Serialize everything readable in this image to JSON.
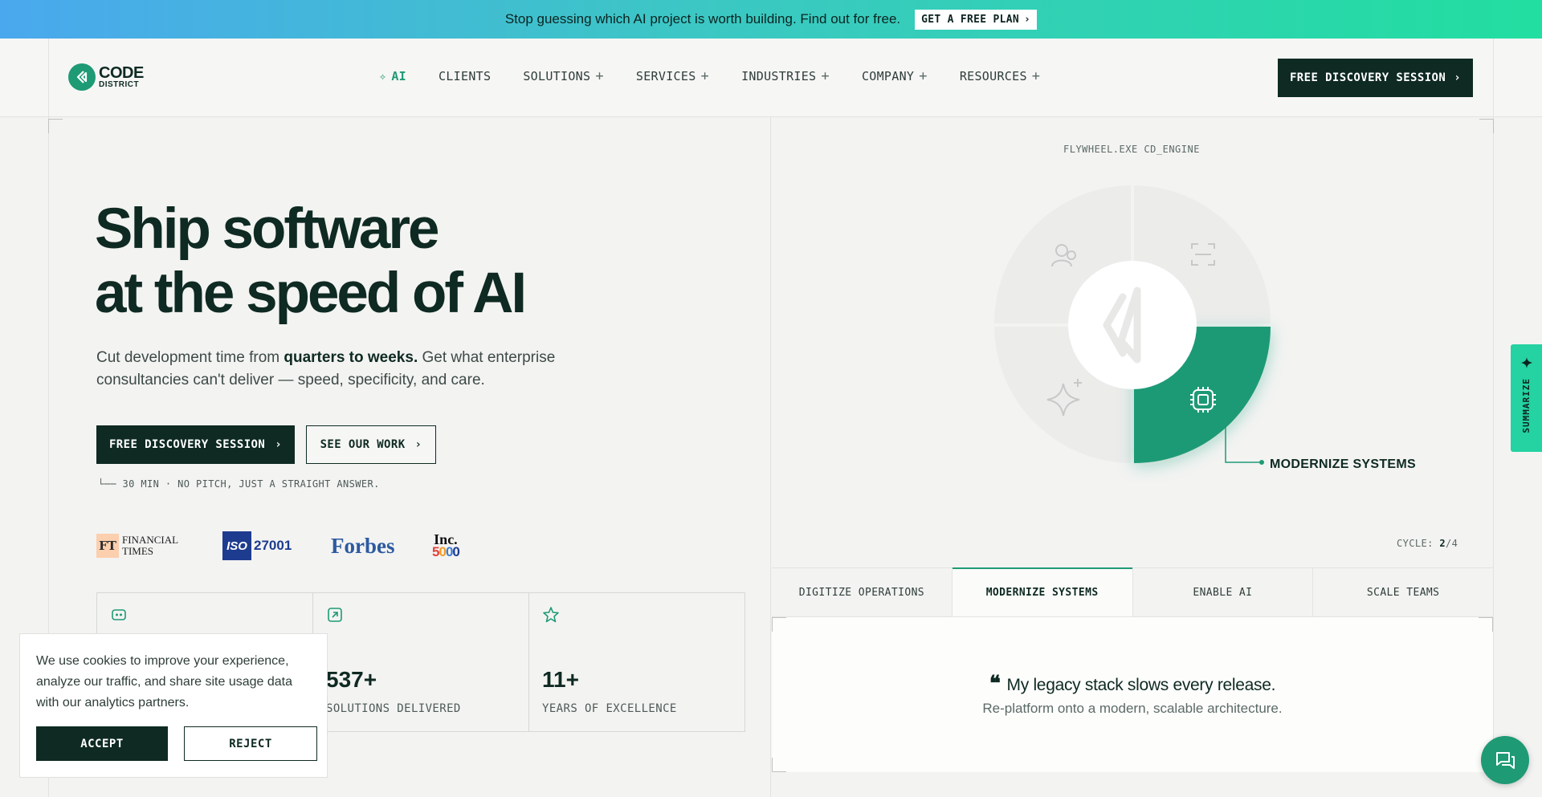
{
  "promo": {
    "text": "Stop guessing which AI project is worth building. Find out for free.",
    "button": "GET A FREE PLAN"
  },
  "header": {
    "logo_line1": "CODE",
    "logo_line2": "DISTRICT",
    "nav": {
      "ai": "AI",
      "clients": "CLIENTS",
      "solutions": "SOLUTIONS",
      "services": "SERVICES",
      "industries": "INDUSTRIES",
      "company": "COMPANY",
      "resources": "RESOURCES"
    },
    "cta": "FREE DISCOVERY SESSION"
  },
  "hero": {
    "title_line1": "Ship software",
    "title_line2": "at the speed of AI",
    "sub_pre": "Cut development time from ",
    "sub_bold": "quarters to weeks.",
    "sub_post": " Get what enterprise consultancies can't deliver — speed, specificity, and care.",
    "primary_button": "FREE DISCOVERY SESSION",
    "secondary_button": "SEE OUR WORK",
    "note": "30 MIN · NO PITCH, JUST A STRAIGHT ANSWER."
  },
  "press": {
    "ft_mark": "FT",
    "ft_line1": "FINANCIAL",
    "ft_line2": "TIMES",
    "iso_mark": "ISO",
    "iso_number": "27001",
    "forbes": "Forbes",
    "inc_top": "Inc.",
    "inc_bottom": "5000"
  },
  "stats": [
    {
      "icon": "robot-icon",
      "value": "",
      "label": ""
    },
    {
      "icon": "arrow-up-right-icon",
      "value": "537+",
      "label": "SOLUTIONS DELIVERED"
    },
    {
      "icon": "star-badge-icon",
      "value": "11+",
      "label": "YEARS OF EXCELLENCE"
    }
  ],
  "flywheel": {
    "title": "FLYWHEEL.EXE CD_ENGINE",
    "active_label": "MODERNIZE SYSTEMS",
    "cycle_label": "CYCLE: ",
    "cycle_current": "2",
    "cycle_total": "/4",
    "colors": {
      "active": "#1e9a74",
      "inactive": "#ececeb"
    }
  },
  "tabs": [
    "DIGITIZE OPERATIONS",
    "MODERNIZE SYSTEMS",
    "ENABLE AI",
    "SCALE TEAMS"
  ],
  "quote": {
    "text": "My legacy stack slows every release.",
    "sub": "Re-platform onto a modern, scalable architecture."
  },
  "summarize": "SUMMARIZE",
  "cookie": {
    "text": "We use cookies to improve your experience, analyze our traffic, and share site usage data with our analytics partners.",
    "accept": "ACCEPT",
    "reject": "REJECT"
  }
}
